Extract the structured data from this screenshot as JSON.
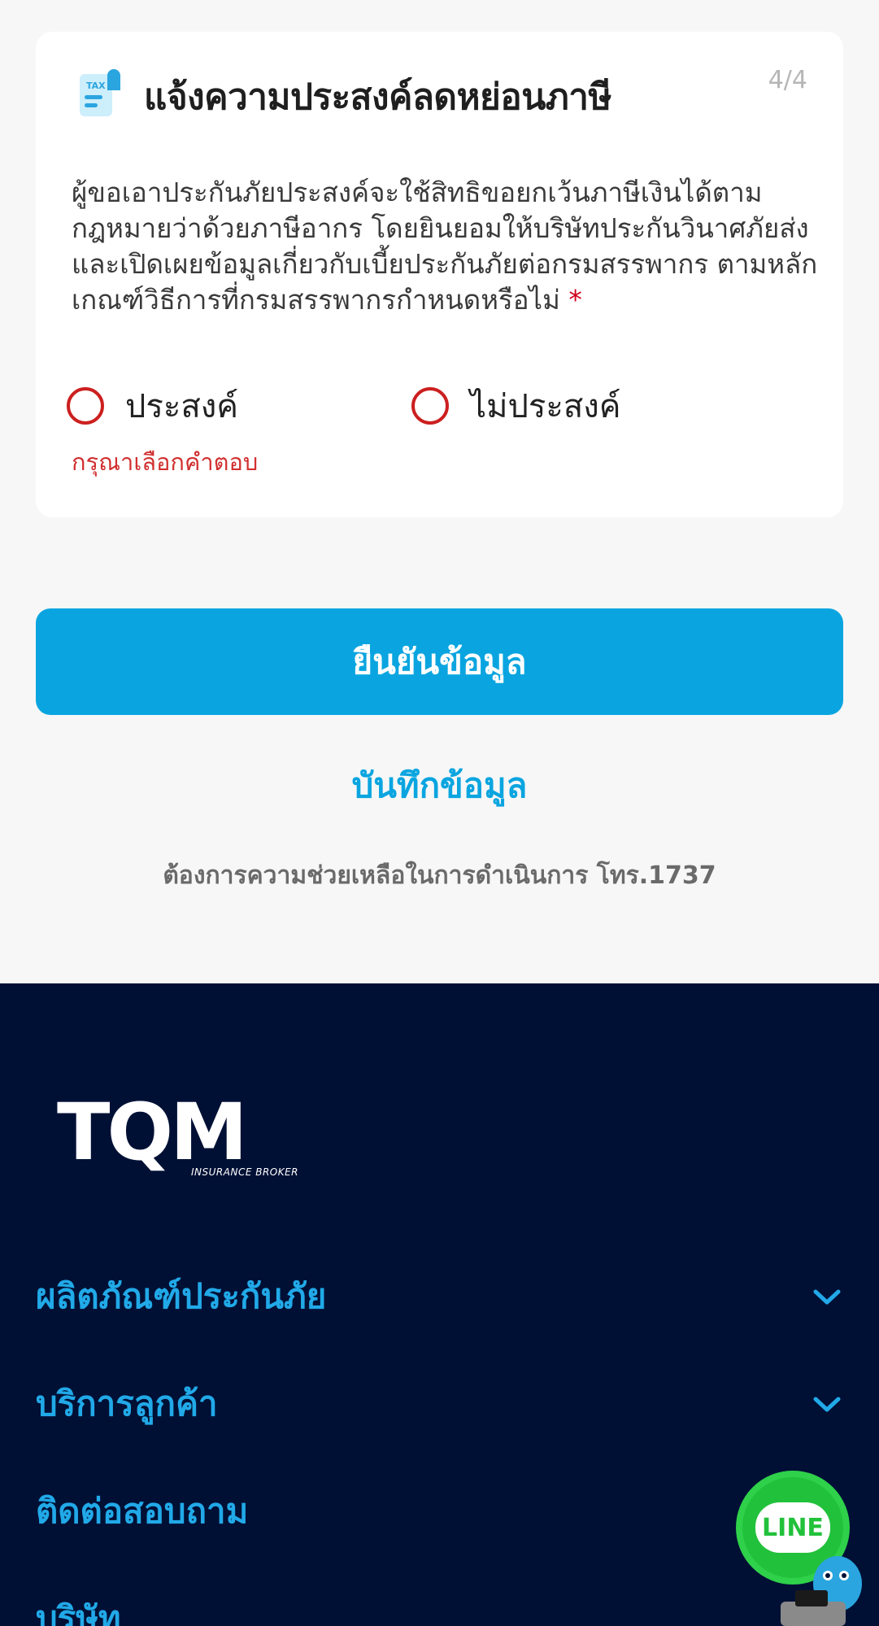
{
  "card": {
    "title": "แจ้งความประสงค์ลดหย่อนภาษี",
    "step": "4/4",
    "question": "ผู้ขอเอาประกันภัยประสงค์จะใช้สิทธิขอยกเว้นภาษีเงินได้ตามกฎหมายว่าด้วยภาษีอากร โดยยินยอมให้บริษัทประกันวินาศภัยส่งและเปิดเผยข้อมูลเกี่ยวกับเบี้ยประกันภัยต่อกรมสรรพากร ตามหลักเกณฑ์วิธีการที่กรมสรรพากรกำหนดหรือไม่",
    "required_mark": "*",
    "options": [
      "ประสงค์",
      "ไม่ประสงค์"
    ],
    "error": "กรุณาเลือกคำตอบ"
  },
  "actions": {
    "confirm": "ยืนยันข้อมูล",
    "save": "บันทึกข้อมูล",
    "help": "ต้องการความช่วยเหลือในการดำเนินการ โทร.1737"
  },
  "footer": {
    "logo_text": "TQM",
    "logo_sub": "INSURANCE BROKER",
    "nav": [
      "ผลิตภัณฑ์ประกันภัย",
      "บริการลูกค้า",
      "ติดต่อสอบถาม",
      "บริษัท"
    ]
  },
  "chat": {
    "label": "LINE"
  },
  "colors": {
    "accent": "#0aa5e0",
    "error": "#d23030",
    "footer_bg": "#001035",
    "line_green": "#22c13b"
  },
  "icons": [
    "tax-document-icon",
    "chevron-down-icon",
    "line-chat-icon",
    "mascot-icon"
  ]
}
